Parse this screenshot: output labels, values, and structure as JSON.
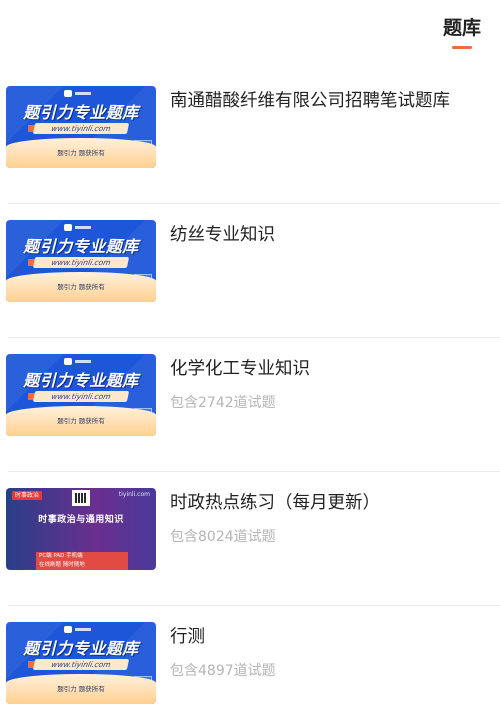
{
  "header": {
    "tab_label": "题库",
    "accent_color": "#ef6a3c"
  },
  "items": [
    {
      "title": "南通醋酸纤维有限公司招聘笔试题库",
      "subtitle": "",
      "thumbnail": {
        "style": "blue-banner",
        "brand": "题引力专业题库",
        "url": "www.tiyinli.com",
        "footer": "题引力 题获所有"
      }
    },
    {
      "title": "纺丝专业知识",
      "subtitle": "",
      "thumbnail": {
        "style": "blue-banner",
        "brand": "题引力专业题库",
        "url": "www.tiyinli.com",
        "footer": "题引力 题获所有"
      }
    },
    {
      "title": "化学化工专业知识",
      "subtitle": "包含2742道试题",
      "thumbnail": {
        "style": "blue-banner",
        "brand": "题引力专业题库",
        "url": "www.tiyinli.com",
        "footer": "题引力 题获所有"
      }
    },
    {
      "title": "时政热点练习（每月更新）",
      "subtitle": "包含8024道试题",
      "thumbnail": {
        "style": "purple-current-affairs",
        "tag": "时事政治",
        "site": "tiyinli.com",
        "headline": "时事政治与通用知识",
        "banner_line1": "PC端 PAD 手机端",
        "banner_line2": "在线刷题 随时随地"
      }
    },
    {
      "title": "行测",
      "subtitle": "包含4897道试题",
      "thumbnail": {
        "style": "blue-banner",
        "brand": "题引力专业题库",
        "url": "www.tiyinli.com",
        "footer": "题引力 题获所有"
      }
    }
  ]
}
